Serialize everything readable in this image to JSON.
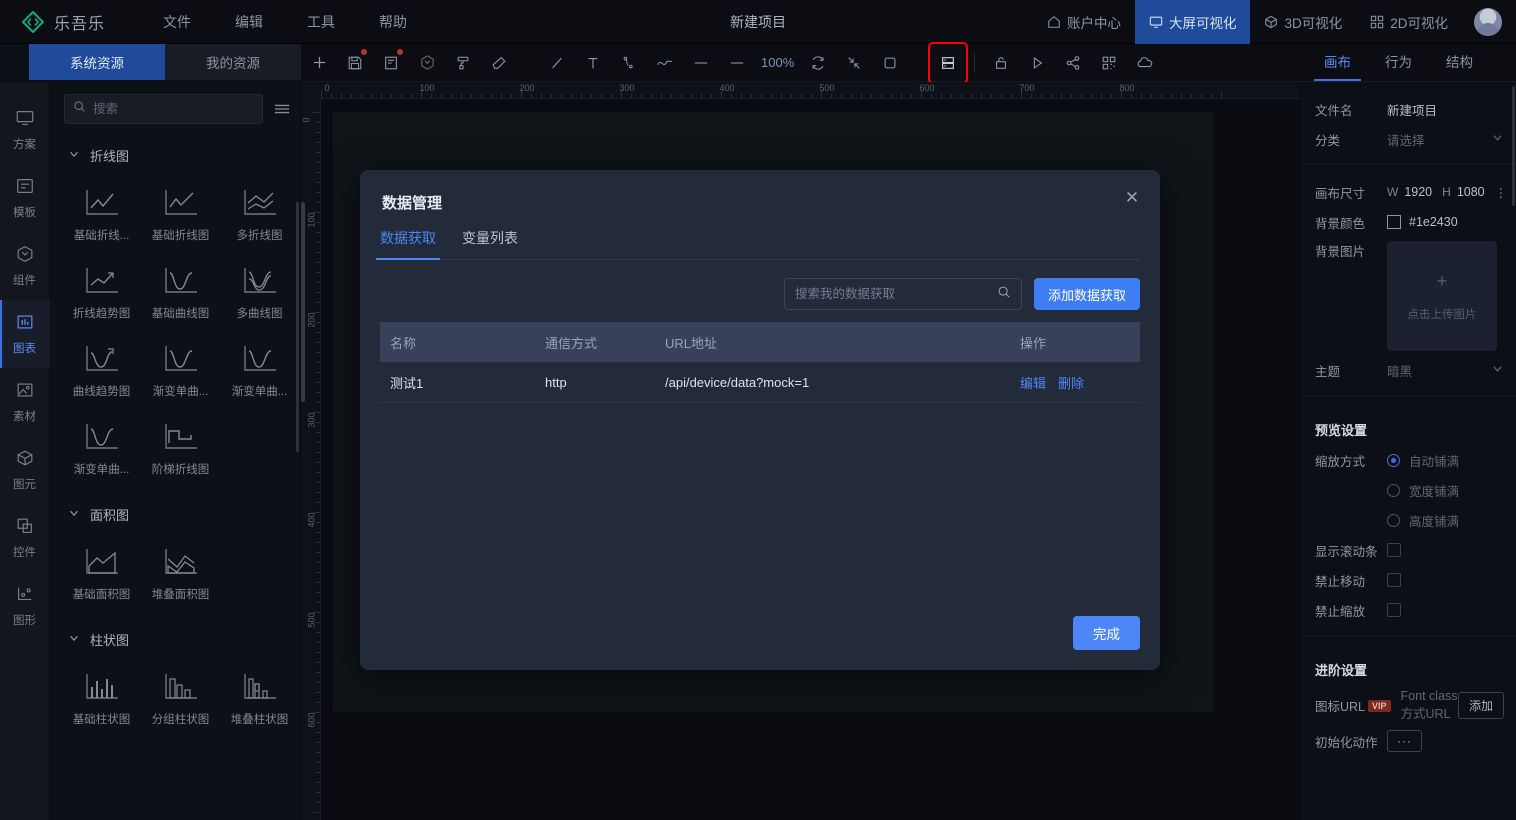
{
  "header": {
    "brand": "乐吾乐",
    "menu": [
      "文件",
      "编辑",
      "工具",
      "帮助"
    ],
    "project_title": "新建项目",
    "right_items": [
      {
        "label": "账户中心",
        "icon": "home-icon",
        "active": false
      },
      {
        "label": "大屏可视化",
        "icon": "monitor-icon",
        "active": true
      },
      {
        "label": "3D可视化",
        "icon": "cube-icon",
        "active": false
      },
      {
        "label": "2D可视化",
        "icon": "grid-icon",
        "active": false
      }
    ],
    "accent": "#1f4b9a"
  },
  "resource_tabs": [
    {
      "label": "系统资源",
      "active": true
    },
    {
      "label": "我的资源",
      "active": false
    }
  ],
  "toolbar": {
    "zoom_level": "100%",
    "items": [
      {
        "name": "add-icon",
        "badge": false
      },
      {
        "name": "save-icon",
        "badge": true
      },
      {
        "name": "file-note-icon",
        "badge": true
      },
      {
        "name": "component-icon",
        "badge": false
      },
      {
        "name": "format-brush-icon",
        "badge": false
      },
      {
        "name": "eraser-icon",
        "badge": false
      },
      {
        "name": "line-icon",
        "badge": false
      },
      {
        "name": "text-icon",
        "badge": false
      },
      {
        "name": "polyline-icon",
        "badge": false
      },
      {
        "name": "curve-icon",
        "badge": false
      },
      {
        "name": "dash-icon",
        "badge": false
      },
      {
        "name": "minus-icon",
        "badge": false
      },
      {
        "name": "refresh-icon",
        "badge": false
      },
      {
        "name": "fit-icon",
        "badge": false
      },
      {
        "name": "frame-icon",
        "badge": false
      },
      {
        "name": "data-manage-icon",
        "badge": false,
        "highlighted": true
      },
      {
        "name": "lock-icon",
        "badge": false
      },
      {
        "name": "play-icon",
        "badge": false
      },
      {
        "name": "share-icon",
        "badge": false
      },
      {
        "name": "qrcode-icon",
        "badge": false
      },
      {
        "name": "cloud-icon",
        "badge": false
      }
    ],
    "highlight_color": "#ff0000"
  },
  "rail": [
    {
      "label": "方案",
      "icon": "monitor-icon",
      "active": false
    },
    {
      "label": "模板",
      "icon": "template-icon",
      "active": false
    },
    {
      "label": "组件",
      "icon": "hexagon-icon",
      "active": false
    },
    {
      "label": "图表",
      "icon": "chart-icon",
      "active": true
    },
    {
      "label": "素材",
      "icon": "image-icon",
      "active": false
    },
    {
      "label": "图元",
      "icon": "cube-icon",
      "active": false
    },
    {
      "label": "控件",
      "icon": "widget-icon",
      "active": false
    },
    {
      "label": "图形",
      "icon": "shape-icon",
      "active": false
    }
  ],
  "library": {
    "search_placeholder": "搜索",
    "groups": [
      {
        "title": "折线图",
        "items": [
          {
            "label": "基础折线...",
            "thumb": "line"
          },
          {
            "label": "基础折线图",
            "thumb": "line2"
          },
          {
            "label": "多折线图",
            "thumb": "multiline"
          },
          {
            "label": "折线趋势图",
            "thumb": "trend"
          },
          {
            "label": "基础曲线图",
            "thumb": "curve"
          },
          {
            "label": "多曲线图",
            "thumb": "multicurve"
          },
          {
            "label": "曲线趋势图",
            "thumb": "curvetrend"
          },
          {
            "label": "渐变单曲...",
            "thumb": "curve"
          },
          {
            "label": "渐变单曲...",
            "thumb": "curve"
          },
          {
            "label": "渐变单曲...",
            "thumb": "curve"
          },
          {
            "label": "阶梯折线图",
            "thumb": "step"
          }
        ]
      },
      {
        "title": "面积图",
        "items": [
          {
            "label": "基础面积图",
            "thumb": "area"
          },
          {
            "label": "堆叠面积图",
            "thumb": "stackarea"
          }
        ]
      },
      {
        "title": "柱状图",
        "items": [
          {
            "label": "基础柱状图",
            "thumb": "bar"
          },
          {
            "label": "分组柱状图",
            "thumb": "groupbar"
          },
          {
            "label": "堆叠柱状图",
            "thumb": "stackbar"
          }
        ]
      }
    ]
  },
  "canvas": {
    "ruler_h_labels": [
      "0",
      "100",
      "200",
      "300",
      "400",
      "500",
      "600",
      "700",
      "800"
    ],
    "ruler_v_labels": [
      "0",
      "100",
      "200",
      "300",
      "400",
      "500",
      "600"
    ]
  },
  "modal": {
    "title": "数据管理",
    "close_icon": "close-icon",
    "tabs": [
      {
        "label": "数据获取",
        "active": true
      },
      {
        "label": "变量列表",
        "active": false
      }
    ],
    "search_placeholder": "搜索我的数据获取",
    "add_button": "添加数据获取",
    "table": {
      "columns": [
        "名称",
        "通信方式",
        "URL地址",
        "操作"
      ],
      "rows": [
        {
          "name": "测试1",
          "protocol": "http",
          "url": "/api/device/data?mock=1",
          "edit": "编辑",
          "delete": "删除"
        }
      ]
    },
    "done_button": "完成",
    "accent": "#4d87f7"
  },
  "right_panel": {
    "tabs": [
      {
        "label": "画布",
        "active": true
      },
      {
        "label": "行为",
        "active": false
      },
      {
        "label": "结构",
        "active": false
      }
    ],
    "file": {
      "label": "文件名",
      "value": "新建项目"
    },
    "category": {
      "label": "分类",
      "placeholder": "请选择"
    },
    "canvas_size": {
      "label": "画布尺寸",
      "w_key": "W",
      "w_value": "1920",
      "h_key": "H",
      "h_value": "1080"
    },
    "bg_color": {
      "label": "背景颜色",
      "value": "#1e2430"
    },
    "bg_image": {
      "label": "背景图片",
      "upload_text": "点击上传图片"
    },
    "theme": {
      "label": "主题",
      "value": "暗黑"
    },
    "preview": {
      "title": "预览设置",
      "scale_label": "缩放方式",
      "scale_options": [
        {
          "label": "自动铺满",
          "checked": true
        },
        {
          "label": "宽度铺满",
          "checked": false
        },
        {
          "label": "高度铺满",
          "checked": false
        }
      ],
      "checkboxes": [
        {
          "label": "显示滚动条",
          "checked": false
        },
        {
          "label": "禁止移动",
          "checked": false
        },
        {
          "label": "禁止缩放",
          "checked": false
        }
      ]
    },
    "advanced": {
      "title": "进阶设置",
      "icon_url_label": "图标URL",
      "vip_badge": "VIP",
      "icon_url_placeholder": "Font class方式URL",
      "add_button": "添加",
      "init_action_label": "初始化动作",
      "init_action_button": "···"
    }
  }
}
